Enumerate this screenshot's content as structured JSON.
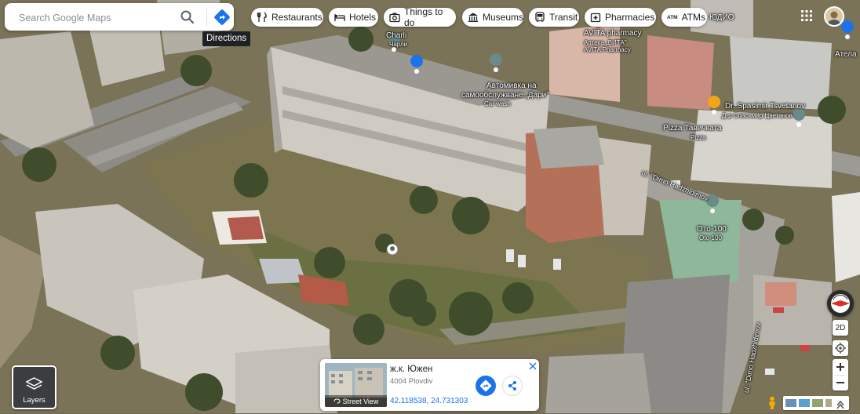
{
  "search": {
    "placeholder": "Search Google Maps",
    "directions_tooltip": "Directions"
  },
  "chips": [
    {
      "label": "Restaurants",
      "icon": "fork-knife-icon"
    },
    {
      "label": "Hotels",
      "icon": "bed-icon"
    },
    {
      "label": "Things to do",
      "icon": "camera-icon"
    },
    {
      "label": "Museums",
      "icon": "museum-icon"
    },
    {
      "label": "Transit",
      "icon": "bus-icon"
    },
    {
      "label": "Pharmacies",
      "icon": "pharmacy-icon"
    },
    {
      "label": "ATMs",
      "icon": "atm-icon"
    }
  ],
  "atm_icon_text": "ATM",
  "map_labels": {
    "charli": "Charli",
    "charli_cyr": "Чарли",
    "avita_top": "ЮДИО",
    "avita": "AVITA pharmacy",
    "avita_cyr": "Аптека „ВИТА\"",
    "avita_lat": "AVITA Pharmacy",
    "atela": "Атела",
    "carwash_1": "Автомивка на",
    "carwash_2": "самообслужване „Дари\"",
    "carwash_3": "Car wash",
    "doctor": "Dr. Spasimir Tsvetanov",
    "doctor_cyr": "Д-р Спасимир Цветанов",
    "pizza": "Pizza Тавичката",
    "pizza_lat": "Pizza",
    "road1": "ul. \"Dimo Hadzhidimov",
    "oto": "Ото-100",
    "oto_lat": "Oto-100",
    "road2": "ul. \"Dimo Hadzhidimov"
  },
  "place_card": {
    "title": "ж.к. Южен",
    "subtitle": "4004 Plovdiv",
    "coords": "42.118538, 24.731303",
    "street_view": "Street View"
  },
  "controls": {
    "mode": "2D",
    "layers": "Layers"
  },
  "colors": {
    "accent": "#1a73e8",
    "pin_gray": "#6b8a8a",
    "pin_orange": "#f2a516"
  }
}
